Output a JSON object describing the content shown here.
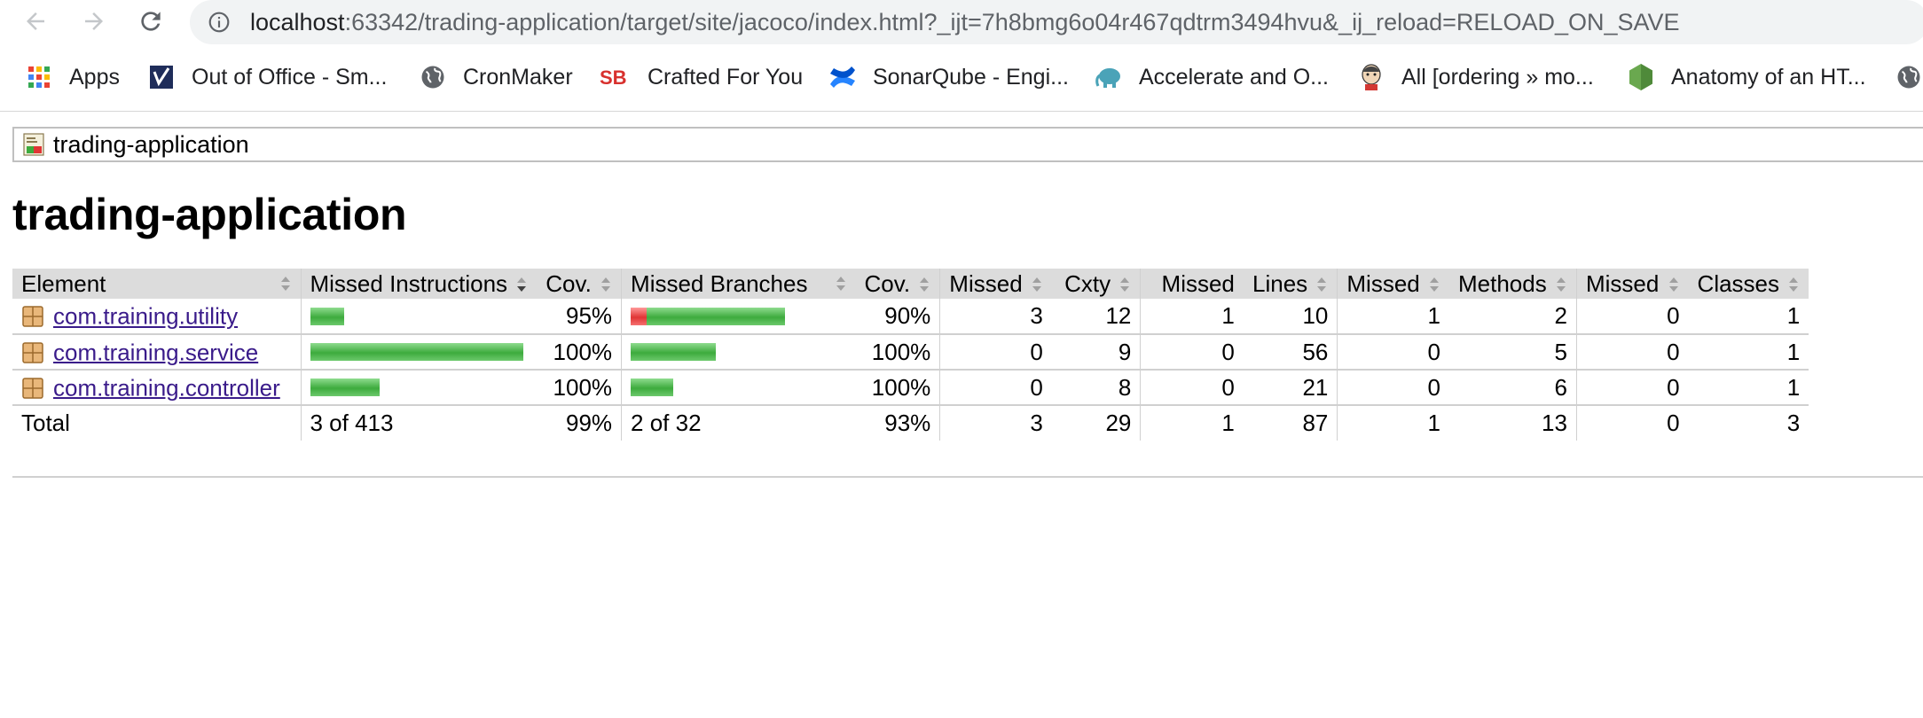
{
  "browser": {
    "url_host": "localhost",
    "url_rest": ":63342/trading-application/target/site/jacoco/index.html?_ijt=7h8bmg6o04r467qdtrm3494hvu&_ij_reload=RELOAD_ON_SAVE",
    "bookmarks": [
      {
        "label": "Apps",
        "icon": "apps-grid-icon"
      },
      {
        "label": "Out of Office - Sm...",
        "icon": "checkmark-logo-icon"
      },
      {
        "label": "CronMaker",
        "icon": "globe-icon"
      },
      {
        "label": "Crafted For You",
        "icon": "sb-logo-icon"
      },
      {
        "label": "SonarQube - Engi...",
        "icon": "confluence-icon"
      },
      {
        "label": "Accelerate and O...",
        "icon": "elephant-icon"
      },
      {
        "label": "All [ordering » mo...",
        "icon": "jenkins-icon"
      },
      {
        "label": "Anatomy of an HT...",
        "icon": "nodejs-hexagon-icon"
      }
    ]
  },
  "report": {
    "breadcrumb": "trading-application",
    "title": "trading-application",
    "headers": {
      "element": "Element",
      "missed_instructions": "Missed Instructions",
      "cov1": "Cov.",
      "missed_branches": "Missed Branches",
      "cov2": "Cov.",
      "missed_cxty": "Missed",
      "cxty": "Cxty",
      "missed_lines": "Missed",
      "lines": "Lines",
      "missed_methods": "Missed",
      "methods": "Methods",
      "missed_classes": "Missed",
      "classes": "Classes"
    },
    "rows": [
      {
        "element": "com.training.utility",
        "instr_cov": "95%",
        "branch_cov": "90%",
        "missed_cxty": "3",
        "cxty": "12",
        "missed_lines": "1",
        "lines": "10",
        "missed_methods": "1",
        "methods": "2",
        "missed_classes": "0",
        "classes": "1"
      },
      {
        "element": "com.training.service",
        "instr_cov": "100%",
        "branch_cov": "100%",
        "missed_cxty": "0",
        "cxty": "9",
        "missed_lines": "0",
        "lines": "56",
        "missed_methods": "0",
        "methods": "5",
        "missed_classes": "0",
        "classes": "1"
      },
      {
        "element": "com.training.controller",
        "instr_cov": "100%",
        "branch_cov": "100%",
        "missed_cxty": "0",
        "cxty": "8",
        "missed_lines": "0",
        "lines": "21",
        "missed_methods": "0",
        "methods": "6",
        "missed_classes": "0",
        "classes": "1"
      }
    ],
    "total": {
      "label": "Total",
      "missed_instructions": "3 of 413",
      "instr_cov": "99%",
      "missed_branches": "2 of 32",
      "branch_cov": "93%",
      "missed_cxty": "3",
      "cxty": "29",
      "missed_lines": "1",
      "lines": "87",
      "missed_methods": "1",
      "methods": "13",
      "missed_classes": "0",
      "classes": "3"
    },
    "colors": {
      "covered": "#3dab3d",
      "missed": "#e03535"
    }
  }
}
